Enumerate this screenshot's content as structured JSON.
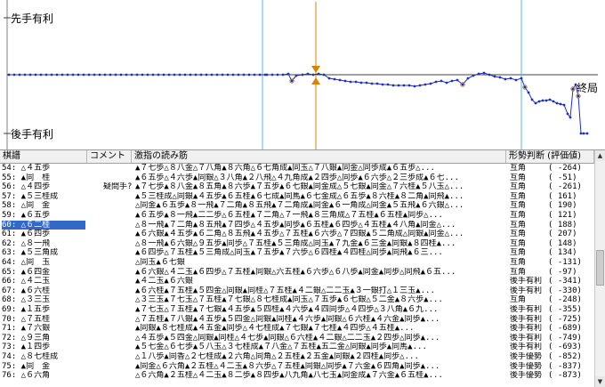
{
  "chart": {
    "sente_label": "先手有利",
    "gote_label": "後手有利",
    "end_label": "終局",
    "colors": {
      "line": "#2030c0",
      "marker": "#e08000",
      "grid": "#4fb8d8"
    }
  },
  "table": {
    "headers": [
      "棋譜",
      "コメント",
      "激指の読み筋",
      "形勢判断 (評価値)"
    ],
    "selected_index": 6,
    "rows": [
      {
        "move": "54: △４五歩",
        "comment": "",
        "line": "▲７七歩△８八金△７八角▲８六角△６七角成▲同玉△７八銀▲同金△同歩成▲６五歩△...",
        "judge": "互角",
        "score": "( -264)"
      },
      {
        "move": "55: ▲同　桂",
        "comment": "",
        "line": "▲６五歩△４六歩▲同銀△３八角▲２八飛△４九角成▲２四歩△同歩▲６六歩△２三歩成▲６七...",
        "judge": "互角",
        "score": "( -51)"
      },
      {
        "move": "56: △４四歩",
        "comment": "疑問手?",
        "line": "▲７七歩▲８八金▲８五角▲８六歩▲７五歩▲６七銀▲同金成△５七銀▲同金△７六桂▲５八玉△...",
        "judge": "互角",
        "score": "( -261)"
      },
      {
        "move": "57: ▲５三桂成",
        "comment": "",
        "line": "▲５三桂成△同銀▲４五歩▲６五桂▲６七成▲同馬▲６七金成△６五歩▲８六桂▲８二角▲同飛▲...",
        "judge": "互角",
        "score": "( 161)"
      },
      {
        "move": "58: △同　金",
        "comment": "",
        "line": "△同金▲６五歩▲８一飛▲７二角▲８五飛▲７二角成▲同金▲６一角成△同金▲５五飛▲６六銀△...",
        "judge": "互角",
        "score": "( 190)"
      },
      {
        "move": "59: ▲６五歩",
        "comment": "",
        "line": "▲６五歩▲８一飛▲二二歩△６五桂▲７二角△７一飛▲８三角成△７五桂▲６五桂▲同歩△...",
        "judge": "互角",
        "score": "( 121)"
      },
      {
        "move": "60: △６二桂",
        "comment": "",
        "line": "△８一飛▲７二角▲８五飛▲７四歩△４五歩▲同歩▲６五桂▲６四歩△４五桂▲４八角▲同金△...",
        "judge": "互角",
        "score": "( 188)"
      },
      {
        "move": "61: ▲６四歩",
        "comment": "",
        "line": "▲６六銀▲４五歩▲６二角△８五飛▲４五歩△７五桂▲６六歩△７四銀▲５二角成△同銀▲同金△...",
        "judge": "互角",
        "score": "( 207)"
      },
      {
        "move": "62: △８一飛",
        "comment": "",
        "line": "△８一飛▲６六銀△９五歩▲同歩△７五桂▲５三角成△同玉▲７九金▲６三金▲同銀▲８四桂▲...",
        "judge": "互角",
        "score": "( 148)"
      },
      {
        "move": "63: ▲５三角成",
        "comment": "",
        "line": "▲６四歩△７五桂▲５三角成△同玉▲７五歩▲７六歩△６四桂▲４四桂△同歩▲同飛▲６三...",
        "judge": "互角",
        "score": "( 134)"
      },
      {
        "move": "64: △同　玉",
        "comment": "",
        "line": "△同玉▲６七銀",
        "judge": "互角",
        "score": "( -131)"
      },
      {
        "move": "65: ▲６四金",
        "comment": "",
        "line": "▲６六銀△４二玉▲６四歩△７五桂▲同銀△六五桂▲６六歩△６八歩▲同金▲同歩△同飛▲６五...",
        "judge": "互角",
        "score": "( -97)"
      },
      {
        "move": "66: △４二玉",
        "comment": "",
        "line": "▲４二玉▲６六銀",
        "judge": "後手有利",
        "score": "( -341)"
      },
      {
        "move": "67: ▲６六桂",
        "comment": "",
        "line": "▲６六桂▲７五桂▲５四金△同銀▲同桂△７五桂▲４二銀△二二玉▲３一銀打△１三玉▲...",
        "judge": "後手有利",
        "score": "( -330)"
      },
      {
        "move": "68: △３三玉",
        "comment": "",
        "line": "△３三玉▲７七玉△７五桂▲７七銀△８七桂成▲同玉△７五歩▲６七銀△５二金▲８六歩▲...",
        "judge": "互角",
        "score": "( -248)"
      },
      {
        "move": "69: ▲１五歩",
        "comment": "",
        "line": "▲７七玉△７五桂▲７七銀▲４五歩▲５四桂▲４六歩▲４四同歩△４四歩△３八角▲６九...",
        "judge": "後手有利",
        "score": "( -355)"
      },
      {
        "move": "70: △７五桂",
        "comment": "",
        "line": "△７五桂▲７八銀▲４五歩▲５四金△同銀▲同桂▲４六歩▲同銀△６六桂▲４六金▲同歩▲...",
        "judge": "後手有利",
        "score": "( -725)"
      },
      {
        "move": "71: ▲７六銀",
        "comment": "",
        "line": "▲同銀▲８七桂成▲４五金▲同歩△４七桂成▲７七銀▲７七桂▲４四歩△４五桂▲...",
        "judge": "後手有利",
        "score": "( -689)"
      },
      {
        "move": "72: △９三角",
        "comment": "",
        "line": "△４五歩▲５四金△同銀▲同桂△４七歩▲同銀△６六桂▲４二銀△二二玉▲２四歩△同歩▲...",
        "judge": "後手有利",
        "score": "( -749)"
      },
      {
        "move": "73: ▲１四歩",
        "comment": "",
        "line": "▲５七金△６七歩▲５八玉△３七桂成▲７八金△７五桂▲五二金△同銀▲同歩▲同馬▲...",
        "judge": "後手有利",
        "score": "( -693)"
      },
      {
        "move": "74: △８七桂成",
        "comment": "",
        "line": "△１八歩▲同香△２七桂成▲２六角△同角△２五桂▲２五金▲同銀▲２四桂▲同歩△...",
        "judge": "後手優勢",
        "score": "( -852)"
      },
      {
        "move": "75: ▲同　金",
        "comment": "",
        "line": "▲同金△６六角▲２五桂△４二玉▲８六歩△７五桂▲同銀△同歩▲７六金▲６四角▲同歩▲...",
        "judge": "後手優勢",
        "score": "( -837)"
      },
      {
        "move": "76: △６六角",
        "comment": "",
        "line": "△６六角▲２五桂△４二玉▲８二歩▲８四歩▲八九角▲八七玉▲同金成▲７六金▲６五桂▲...",
        "judge": "後手優勢",
        "score": "( -873)"
      }
    ]
  }
}
